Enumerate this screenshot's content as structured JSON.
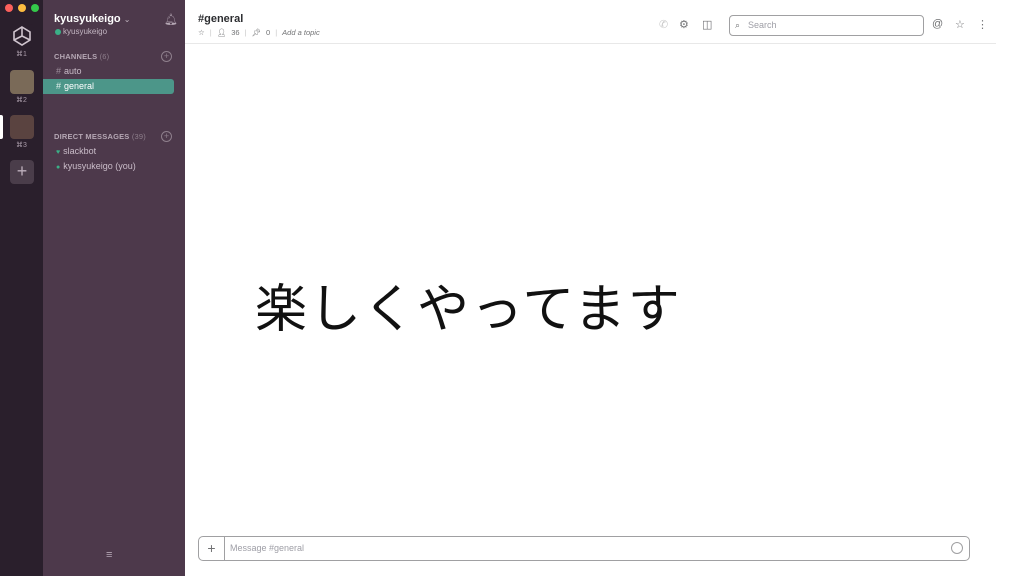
{
  "rail": {
    "team_keys": [
      "⌘1",
      "⌘2",
      "⌘3"
    ],
    "add_label": "+"
  },
  "sidebar": {
    "team_name": "kyusyukeigo",
    "user_name": "kyusyukeigo",
    "channels_header": "CHANNELS",
    "channels_count": "(6)",
    "channels": [
      {
        "label": "auto"
      },
      {
        "label": "general"
      }
    ],
    "dm_header": "DIRECT MESSAGES",
    "dm_count": "(39)",
    "dms": [
      {
        "label": "slackbot"
      },
      {
        "label": "kyusyukeigo (you)"
      }
    ]
  },
  "header": {
    "channel_title": "#general",
    "members": "36",
    "pins": "0",
    "topic": "Add a topic",
    "search_placeholder": "Search"
  },
  "messages": {
    "big_text": "楽しくやってます"
  },
  "composer": {
    "plus": "+",
    "placeholder": "Message #general"
  }
}
